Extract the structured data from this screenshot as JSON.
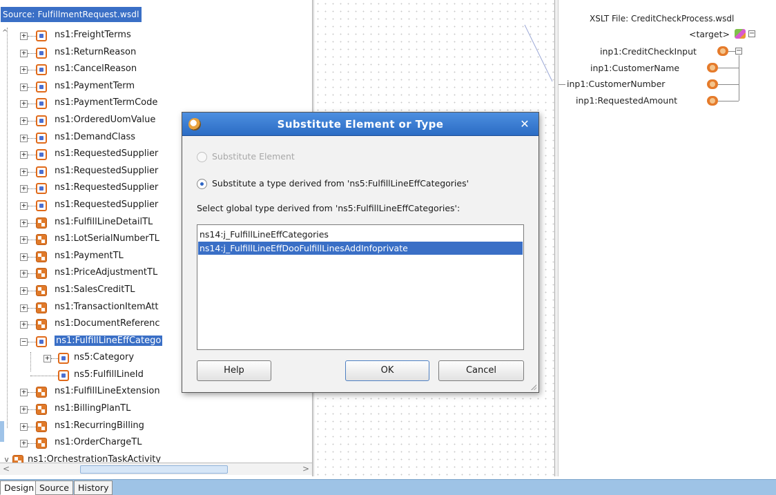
{
  "source_pane": {
    "title": "Source: FulfillmentRequest.wsdl",
    "tree": [
      {
        "label": "ns1:FreightTerms",
        "icon": "element"
      },
      {
        "label": "ns1:ReturnReason",
        "icon": "element"
      },
      {
        "label": "ns1:CancelReason",
        "icon": "element"
      },
      {
        "label": "ns1:PaymentTerm",
        "icon": "element"
      },
      {
        "label": "ns1:PaymentTermCode",
        "icon": "element"
      },
      {
        "label": "ns1:OrderedUomValue",
        "icon": "element"
      },
      {
        "label": "ns1:DemandClass",
        "icon": "element"
      },
      {
        "label": "ns1:RequestedSupplier",
        "icon": "element"
      },
      {
        "label": "ns1:RequestedSupplier",
        "icon": "element"
      },
      {
        "label": "ns1:RequestedSupplier",
        "icon": "element"
      },
      {
        "label": "ns1:RequestedSupplier",
        "icon": "element"
      },
      {
        "label": "ns1:FulfillLineDetailTL",
        "icon": "group"
      },
      {
        "label": "ns1:LotSerialNumberTL",
        "icon": "group"
      },
      {
        "label": "ns1:PaymentTL",
        "icon": "group"
      },
      {
        "label": "ns1:PriceAdjustmentTL",
        "icon": "group"
      },
      {
        "label": "ns1:SalesCreditTL",
        "icon": "group"
      },
      {
        "label": "ns1:TransactionItemAtt",
        "icon": "group"
      },
      {
        "label": "ns1:DocumentReferenc",
        "icon": "group"
      },
      {
        "label": "ns1:FulfillLineEffCatego",
        "icon": "element",
        "selected": true,
        "expanded": true
      },
      {
        "label": "ns5:Category",
        "icon": "element",
        "child": true
      },
      {
        "label": "ns5:FulfillLineId",
        "icon": "element",
        "child": true,
        "leaf": true
      },
      {
        "label": "ns1:FulfillLineExtension",
        "icon": "group"
      },
      {
        "label": "ns1:BillingPlanTL",
        "icon": "group"
      },
      {
        "label": "ns1:RecurringBilling",
        "icon": "group"
      },
      {
        "label": "ns1:OrderChargeTL",
        "icon": "group"
      },
      {
        "label": "ns1:OrchestrationTaskActivity",
        "icon": "group",
        "root": true
      }
    ]
  },
  "target_pane": {
    "title": "XSLT File: CreditCheckProcess.wsdl",
    "root_label": "<target>",
    "items": [
      {
        "label": "inp1:CreditCheckInput"
      },
      {
        "label": "inp1:CustomerName"
      },
      {
        "label": "inp1:CustomerNumber"
      },
      {
        "label": "inp1:RequestedAmount"
      }
    ]
  },
  "dialog": {
    "title": "Substitute Element or Type",
    "close_label": "✕",
    "option_element": "Substitute Element",
    "option_type": "Substitute a type derived from 'ns5:FulfillLineEffCategories'",
    "select_label": "Select global type derived from 'ns5:FulfillLineEffCategories':",
    "types": [
      "ns14:j_FulfillLineEffCategories",
      "ns14:j_FulfillLineEffDooFulfillLinesAddInfoprivate"
    ],
    "help_label": "Help",
    "ok_label": "OK",
    "cancel_label": "Cancel"
  },
  "tabs": [
    "Design",
    "Source",
    "History"
  ],
  "colors": {
    "selection": "#3a6fc6",
    "titlebar": "#2c6cc4",
    "tabbar": "#9ec3e6"
  }
}
